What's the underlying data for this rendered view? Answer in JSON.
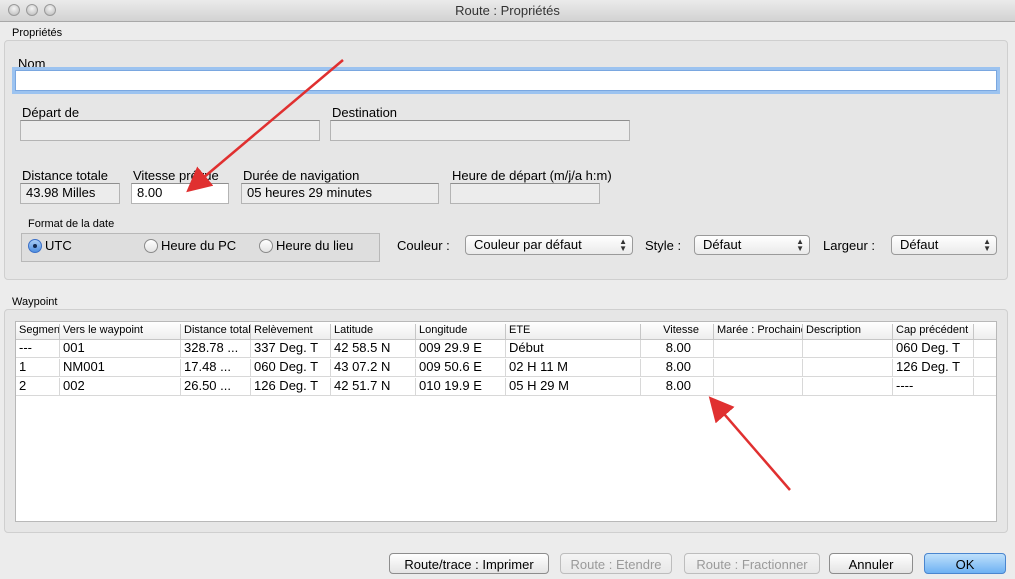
{
  "window": {
    "title": "Route : Propriétés"
  },
  "properties": {
    "section_label": "Propriétés",
    "name_label": "Nom",
    "name_value": "",
    "departure_label": "Départ de",
    "departure_value": "",
    "destination_label": "Destination",
    "destination_value": "",
    "total_distance_label": "Distance totale",
    "total_distance_value": "43.98 Milles",
    "planned_speed_label": "Vitesse prévue",
    "planned_speed_value": "8.00",
    "duration_label": "Durée de navigation",
    "duration_value": "05 heures  29 minutes",
    "departure_time_label": "Heure de départ (m/j/a h:m)",
    "departure_time_value": "",
    "date_format_label": "Format de la date",
    "date_format_options": [
      "UTC",
      "Heure du PC",
      "Heure du lieu"
    ],
    "date_format_selected": "UTC",
    "color_label": "Couleur :",
    "color_value": "Couleur par défaut",
    "style_label": "Style :",
    "style_value": "Défaut",
    "width_label": "Largeur :",
    "width_value": "Défaut"
  },
  "waypoint": {
    "section_label": "Waypoint",
    "columns": [
      "Segment",
      "Vers le waypoint",
      "Distance totale",
      "Relèvement",
      "Latitude",
      "Longitude",
      "ETE",
      "Vitesse",
      "Marée : Prochaine",
      "Description",
      "Cap précédent"
    ],
    "rows": [
      [
        "---",
        "001",
        "328.78 ...",
        "337 Deg. T",
        "42 58.5 N",
        "009 29.9 E",
        "Début",
        "8.00",
        "",
        "",
        "060 Deg. T"
      ],
      [
        "1",
        "NM001",
        "17.48 ...",
        "060 Deg. T",
        "43 07.2 N",
        "009 50.6 E",
        "02 H  11 M",
        "8.00",
        "",
        "",
        "126 Deg. T"
      ],
      [
        "2",
        "002",
        "26.50 ...",
        "126 Deg. T",
        "42 51.7 N",
        "010 19.9 E",
        "05 H  29 M",
        "8.00",
        "",
        "",
        "----"
      ]
    ]
  },
  "buttons": {
    "print": "Route/trace : Imprimer",
    "extend": "Route : Etendre",
    "split": "Route : Fractionner",
    "cancel": "Annuler",
    "ok": "OK"
  },
  "colors": {
    "arrow": "#e03030",
    "focus": "#9cc3f0",
    "default_button": "#6eb1f3"
  }
}
